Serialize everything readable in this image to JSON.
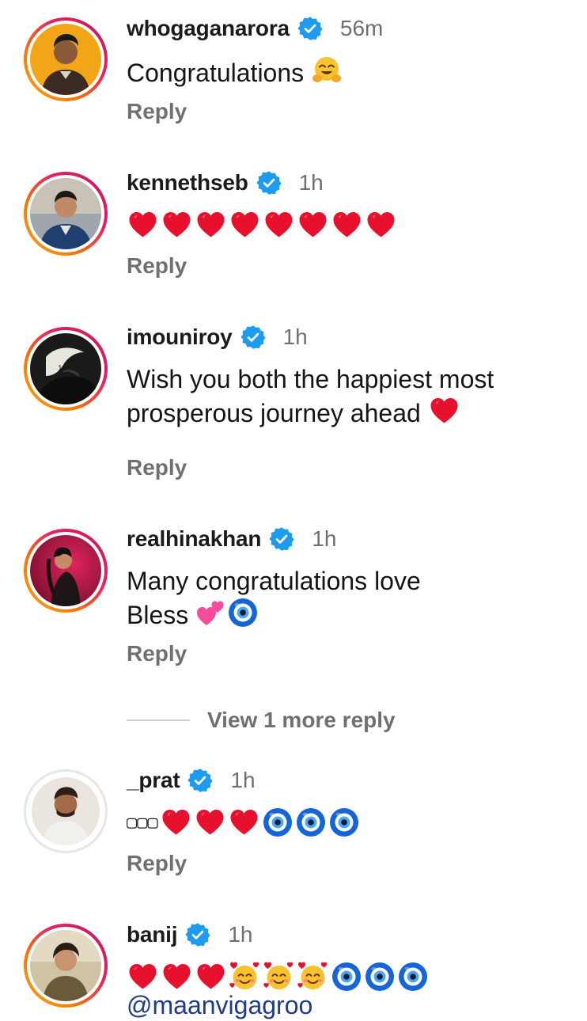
{
  "comments": [
    {
      "username": "whogaganarora",
      "time": "56m",
      "text": "Congratulations",
      "reply": "Reply"
    },
    {
      "username": "kennethseb",
      "time": "1h",
      "reply": "Reply"
    },
    {
      "username": "imouniroy",
      "time": "1h",
      "text_line1": "Wish you both the happiest most",
      "text_line2": "prosperous journey ahead",
      "reply": "Reply"
    },
    {
      "username": "realhinakhan",
      "time": "1h",
      "text_line1": "Many congratulations love",
      "text_line2": "Bless",
      "reply": "Reply"
    },
    {
      "username": "_prat",
      "time": "1h",
      "text_prefix": "▢▢▢",
      "reply": "Reply"
    },
    {
      "username": "banij",
      "time": "1h",
      "mention": "@maanvigagroo"
    }
  ],
  "view_more": "View 1 more reply",
  "icons": {
    "verified": "verified-badge-icon",
    "heart": "red-heart-emoji",
    "hug": "hugging-face-emoji",
    "two_hearts": "two-hearts-emoji",
    "nazar": "nazar-amulet-emoji",
    "smiling_hearts": "smiling-face-with-hearts-emoji"
  },
  "colors": {
    "verified_blue": "#1d9bf0",
    "reply_gray": "#707070",
    "heart_red": "#e8112d",
    "story_ring_start": "#f9a825",
    "story_ring_end": "#c2185b"
  }
}
